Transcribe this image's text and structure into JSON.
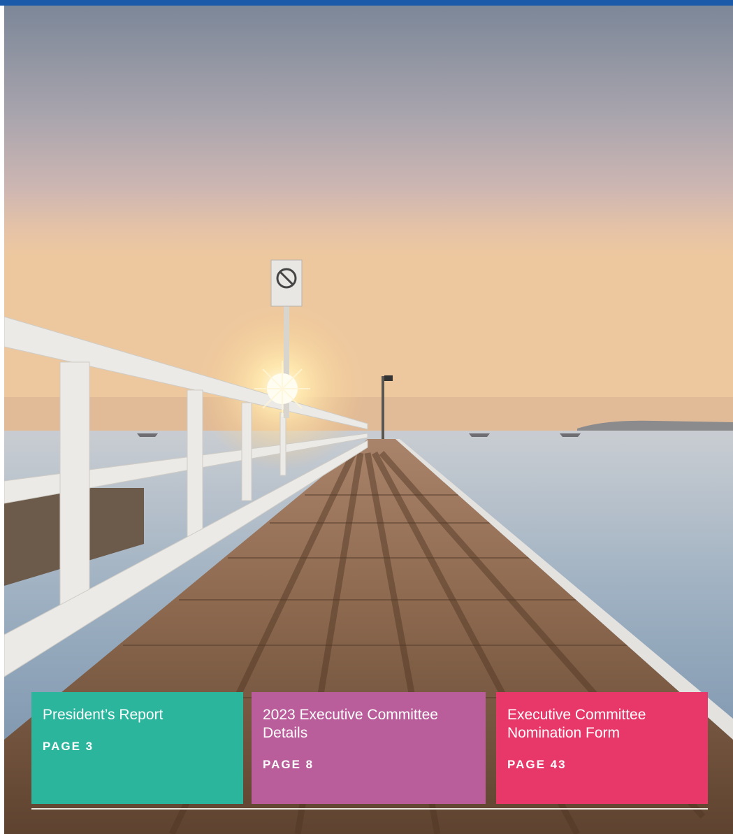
{
  "colors": {
    "top_bar": "#1a5aa8",
    "card_teal": "#2bb59d",
    "card_purple": "#b95e9b",
    "card_pink": "#e8386a"
  },
  "cover_photo": {
    "description_icon": "jetty-sunset-photo"
  },
  "cards": [
    {
      "title": "President’s Report",
      "page_label": "PAGE 3"
    },
    {
      "title": "2023 Executive Committee Details",
      "page_label": "PAGE 8"
    },
    {
      "title": "Executive Committee Nomination Form",
      "page_label": "PAGE 43"
    }
  ]
}
